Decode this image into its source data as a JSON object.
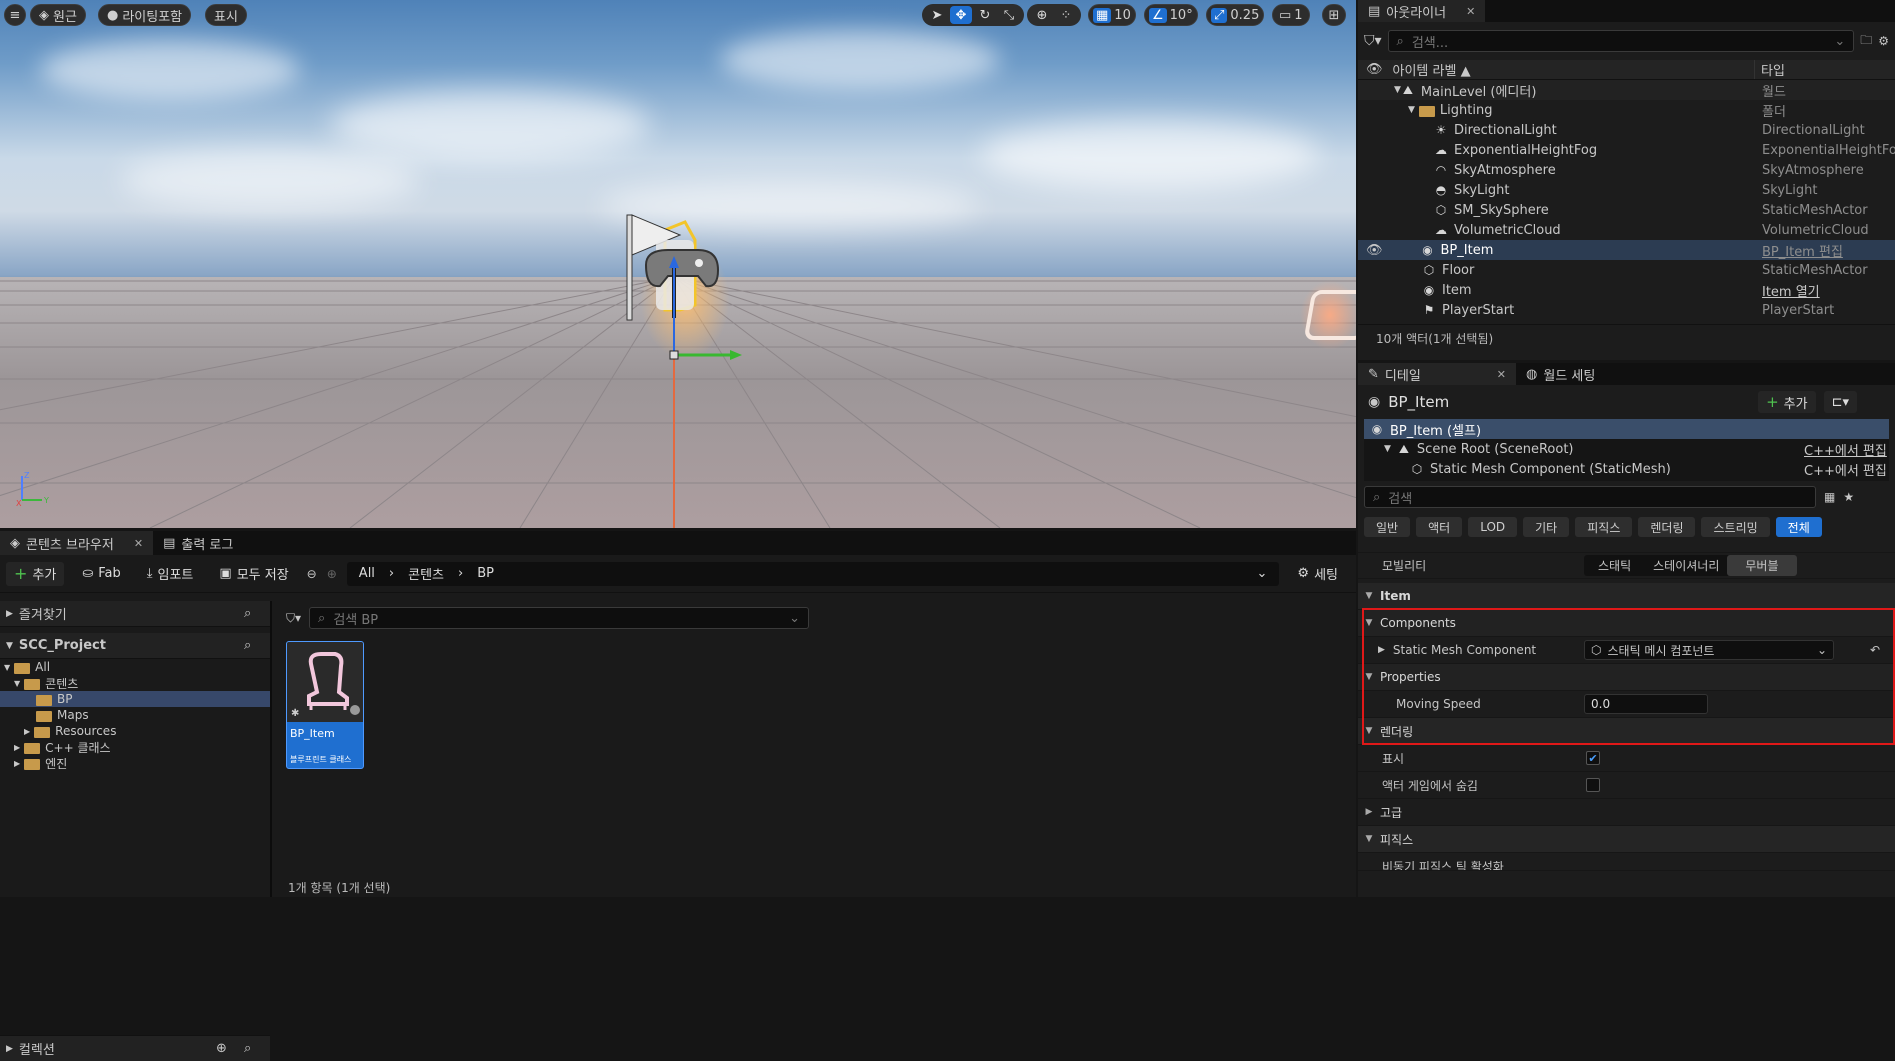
{
  "viewport": {
    "left_buttons": [
      "원근",
      "라이팅포함",
      "표시"
    ],
    "grid_snap": "10",
    "rotate_snap": "10°",
    "scale_snap": "0.25",
    "camera_speed": "1"
  },
  "outliner": {
    "tab_label": "아웃라이너",
    "search_placeholder": "검색...",
    "col_label": "아이템 라벨 ▲",
    "col_type": "타입",
    "rows": [
      {
        "label": "MainLevel (에디터)",
        "type": "월드",
        "icon": "level-icon"
      },
      {
        "label": "Lighting",
        "type": "폴더",
        "icon": "folder-icon"
      },
      {
        "label": "DirectionalLight",
        "type": "DirectionalLight",
        "icon": "sun-icon"
      },
      {
        "label": "ExponentialHeightFog",
        "type": "ExponentialHeightFog",
        "icon": "fog-icon"
      },
      {
        "label": "SkyAtmosphere",
        "type": "SkyAtmosphere",
        "icon": "sky-icon"
      },
      {
        "label": "SkyLight",
        "type": "SkyLight",
        "icon": "skylight-icon"
      },
      {
        "label": "SM_SkySphere",
        "type": "StaticMeshActor",
        "icon": "mesh-icon"
      },
      {
        "label": "VolumetricCloud",
        "type": "VolumetricCloud",
        "icon": "cloud-icon"
      },
      {
        "label": "BP_Item",
        "type": "BP_Item 편집",
        "icon": "blueprint-icon"
      },
      {
        "label": "Floor",
        "type": "StaticMeshActor",
        "icon": "mesh-icon"
      },
      {
        "label": "Item",
        "type": "Item 열기",
        "icon": "actor-icon"
      },
      {
        "label": "PlayerStart",
        "type": "PlayerStart",
        "icon": "flag-icon"
      }
    ],
    "status": "10개 액터(1개 선택됨)"
  },
  "details": {
    "tab_label": "디테일",
    "tab2_label": "월드 세팅",
    "actor_name": "BP_Item",
    "add_label": "추가",
    "components": [
      {
        "label": "BP_Item (셀프)",
        "action": ""
      },
      {
        "label": "Scene Root (SceneRoot)",
        "action": "C++에서 편집"
      },
      {
        "label": "Static Mesh Component (StaticMesh)",
        "action": "C++에서 편집"
      }
    ],
    "search_placeholder": "검색",
    "filters": [
      "일반",
      "액터",
      "LOD",
      "기타",
      "피직스",
      "렌더링",
      "스트리밍",
      "전체"
    ],
    "mobility_label": "모빌리티",
    "mobility_options": [
      "스태틱",
      "스테이셔너리",
      "무버블"
    ],
    "sections": {
      "item": "Item",
      "components": "Components",
      "static_mesh_component": "Static Mesh Component",
      "static_mesh_value": "스태틱 메시 컴포넌트",
      "properties": "Properties",
      "moving_speed": "Moving Speed",
      "moving_speed_value": "0.0",
      "rendering": "렌더링",
      "visible": "표시",
      "hide_in_game": "액터 게임에서 숨김",
      "advanced": "고급",
      "physics": "피직스",
      "physics_row": "비동기 피직스 틱 활성화"
    }
  },
  "content_browser": {
    "tab_label": "콘텐츠 브라우저",
    "tab2_label": "출력 로그",
    "add_label": "추가",
    "fab_label": "Fab",
    "import_label": "임포트",
    "save_all_label": "모두 저장",
    "path": [
      "All",
      "콘텐츠",
      "BP"
    ],
    "settings_label": "세팅",
    "favorites_label": "즐겨찾기",
    "project_label": "SCC_Project",
    "tree": [
      "All",
      "콘텐츠",
      "BP",
      "Maps",
      "Resources",
      "C++ 클래스",
      "엔진"
    ],
    "collections_label": "컬렉션",
    "search_placeholder": "검색 BP",
    "asset_name": "BP_Item",
    "asset_type": "블루프린트 클래스",
    "item_count": "1개 항목 (1개 선택)"
  }
}
